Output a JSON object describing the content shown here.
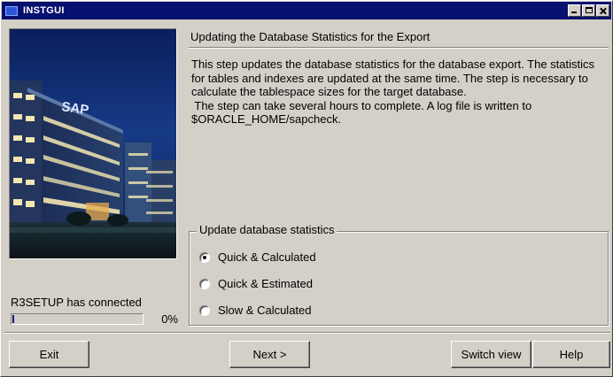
{
  "window": {
    "title": "INSTGUI"
  },
  "step": {
    "title": "Updating the Database Statistics for the Export",
    "description_lines": [
      "This step updates the database statistics for the database export. The statistics",
      "for tables and indexes are updated at the same time. The step is necessary to",
      "calculate the tablespace sizes for the target database.",
      " The step can take several hours to complete. A log file is written to",
      "$ORACLE_HOME/sapcheck."
    ]
  },
  "image": {
    "sign_text": "SAP"
  },
  "status": {
    "text": "R3SETUP has connected",
    "progress_percent": 0,
    "progress_label": "0%"
  },
  "options": {
    "legend": "Update database statistics",
    "items": [
      {
        "label": "Quick & Calculated",
        "selected": true
      },
      {
        "label": "Quick & Estimated",
        "selected": false
      },
      {
        "label": "Slow & Calculated",
        "selected": false
      }
    ]
  },
  "buttons": {
    "exit": "Exit",
    "next": "Next >",
    "switch_view": "Switch view",
    "help": "Help"
  },
  "colors": {
    "title_bar": "#06106e",
    "dialog_face": "#d4d0c8",
    "progress_fill": "#0a1a8a"
  }
}
